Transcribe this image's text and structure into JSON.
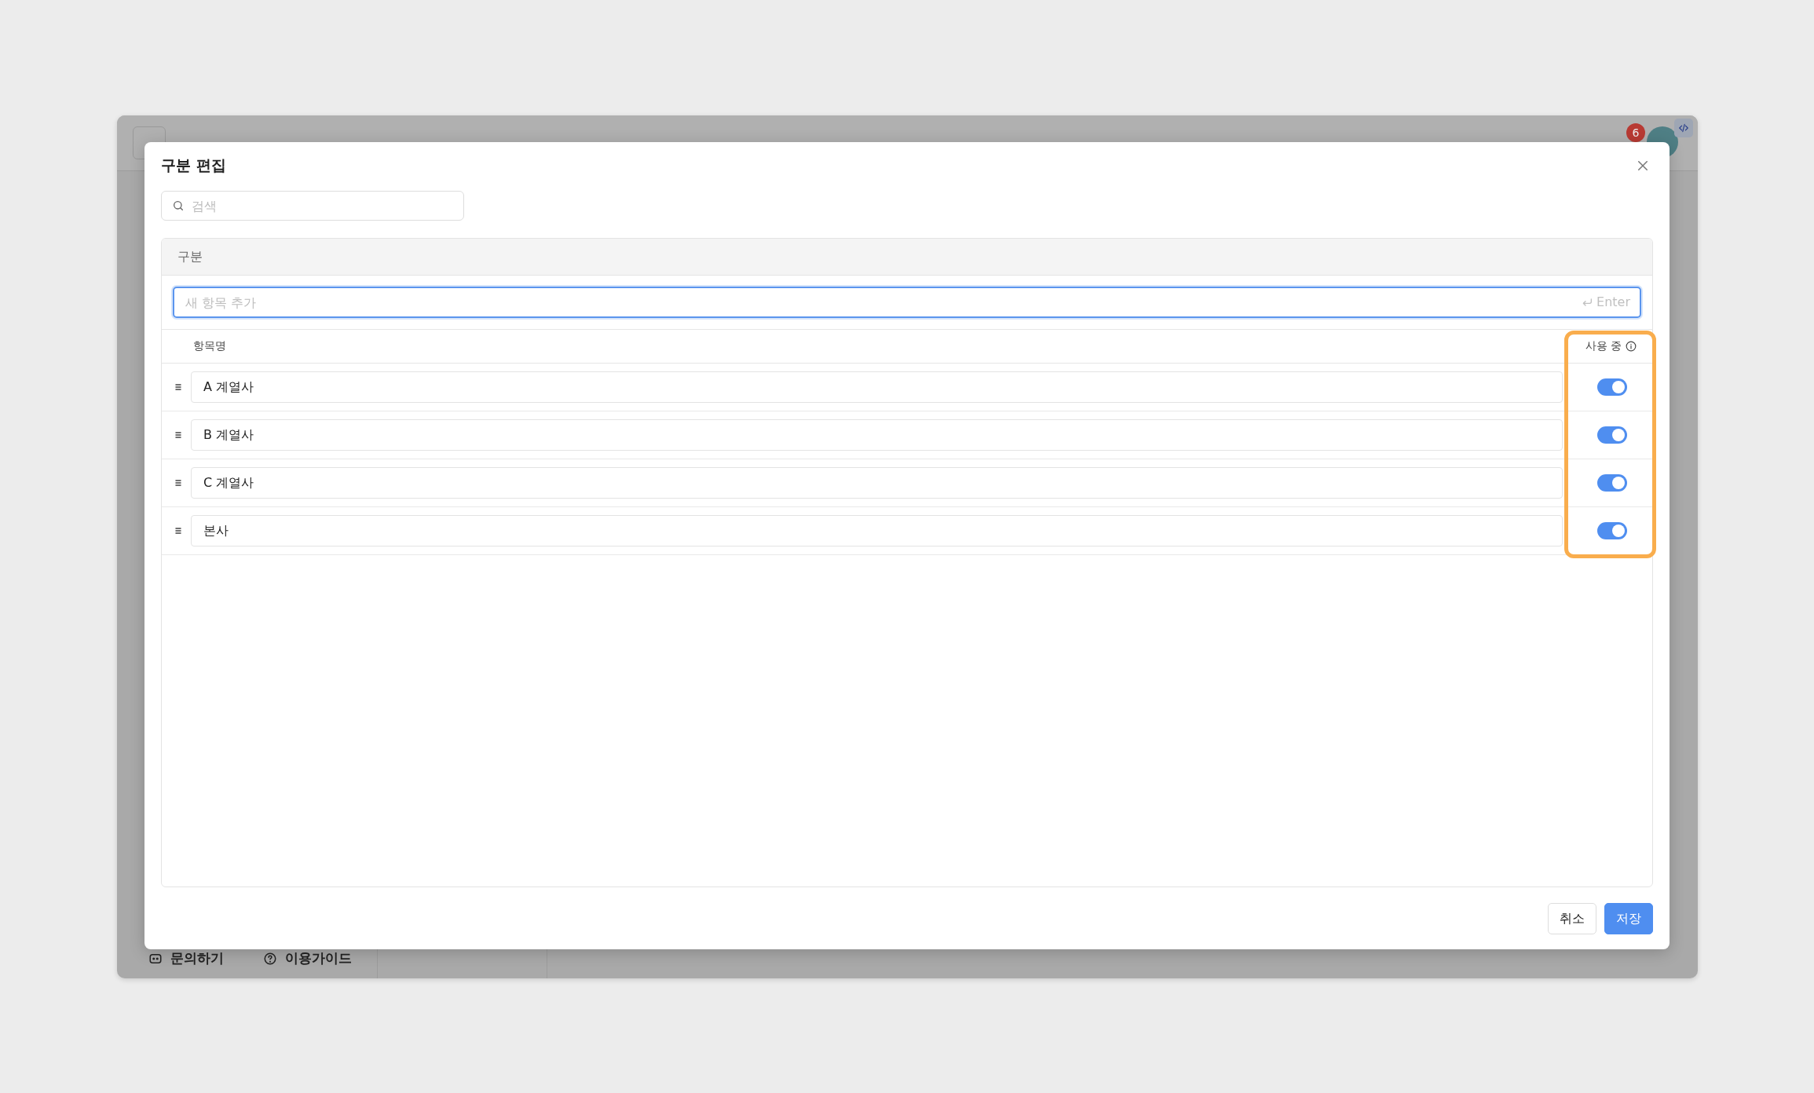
{
  "app": {
    "notification_count": "6",
    "footer_links": [
      {
        "label": "문의하기",
        "kind": "chat"
      },
      {
        "label": "이용가이드",
        "kind": "help"
      }
    ]
  },
  "dialog": {
    "title": "구분 편집",
    "search": {
      "placeholder": "검색"
    },
    "panel_title": "구분",
    "new_item": {
      "placeholder": "새 항목 추가",
      "hint": "Enter"
    },
    "columns": {
      "name": "항목명",
      "in_use": "사용 중"
    },
    "items": [
      {
        "name": "A 계열사",
        "in_use": true
      },
      {
        "name": "B 계열사",
        "in_use": true
      },
      {
        "name": "C 계열사",
        "in_use": true
      },
      {
        "name": "본사",
        "in_use": true
      }
    ],
    "highlight_in_use": true,
    "buttons": [
      {
        "label": "취소",
        "kind": "secondary"
      },
      {
        "label": "저장",
        "kind": "primary"
      }
    ]
  }
}
